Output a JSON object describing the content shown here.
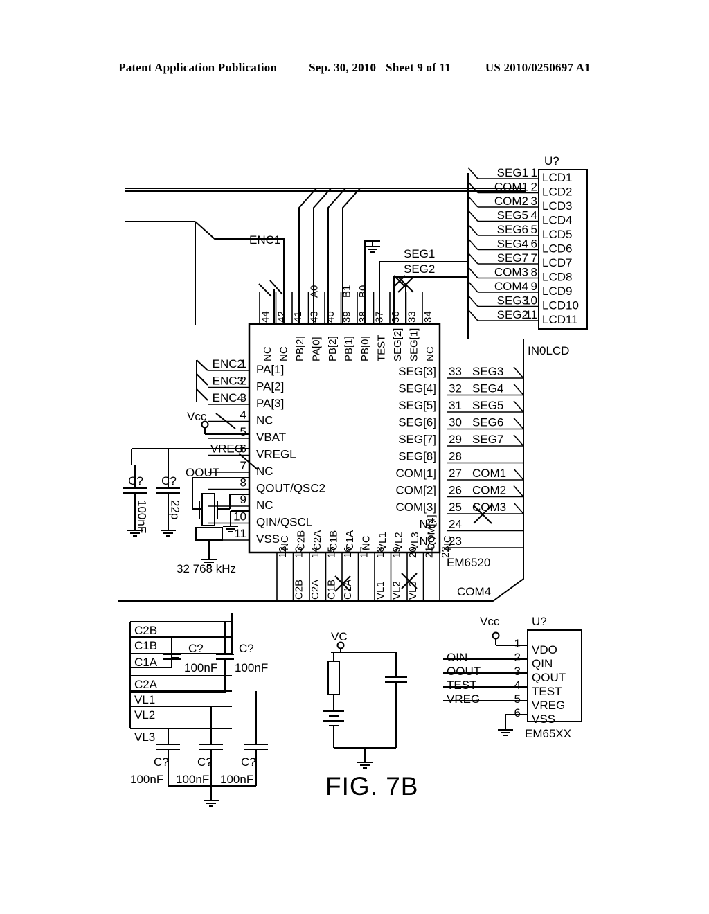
{
  "header": {
    "left": "Patent Application Publication",
    "date": "Sep. 30, 2010",
    "sheet": "Sheet 9 of 11",
    "number": "US 2010/0250697 A1"
  },
  "figure": {
    "caption": "FIG. 7B"
  },
  "lcd_connector": {
    "ref": "U?",
    "name": "IN0LCD",
    "rows": [
      {
        "net": "SEG1",
        "pin": "1",
        "label": "LCD1"
      },
      {
        "net": "COM1",
        "pin": "2",
        "label": "LCD2"
      },
      {
        "net": "COM2",
        "pin": "3",
        "label": "LCD3"
      },
      {
        "net": "SEG5",
        "pin": "4",
        "label": "LCD4"
      },
      {
        "net": "SEG6",
        "pin": "5",
        "label": "LCD5"
      },
      {
        "net": "SEG4",
        "pin": "6",
        "label": "LCD6"
      },
      {
        "net": "SEG7",
        "pin": "7",
        "label": "LCD7"
      },
      {
        "net": "COM3",
        "pin": "8",
        "label": "LCD8"
      },
      {
        "net": "COM4",
        "pin": "9",
        "label": "LCD9"
      },
      {
        "net": "SEG3",
        "pin": "10",
        "label": "LCD10"
      },
      {
        "net": "SEG2",
        "pin": "11",
        "label": "LCD11"
      }
    ]
  },
  "main_ic": {
    "name": "EM6520",
    "left_pins": [
      {
        "pin": "1",
        "label": "PA[1]",
        "net": "ENC2"
      },
      {
        "pin": "2",
        "label": "PA[2]",
        "net": "ENC3"
      },
      {
        "pin": "3",
        "label": "PA[3]",
        "net": "ENC4"
      },
      {
        "pin": "4",
        "label": "NC",
        "net": ""
      },
      {
        "pin": "5",
        "label": "VBAT",
        "net": "Vcc"
      },
      {
        "pin": "6",
        "label": "VREGL",
        "net": "VREG"
      },
      {
        "pin": "7",
        "label": "NC",
        "net": ""
      },
      {
        "pin": "8",
        "label": "QOUT/QSC2",
        "net": "OOUT"
      },
      {
        "pin": "9",
        "label": "NC",
        "net": ""
      },
      {
        "pin": "10",
        "label": "QIN/QSCL",
        "net": ""
      },
      {
        "pin": "11",
        "label": "VSS",
        "net": ""
      }
    ],
    "right_pins": [
      {
        "pin": "33",
        "label": "SEG[3]",
        "net": "SEG3"
      },
      {
        "pin": "32",
        "label": "SEG[4]",
        "net": "SEG4"
      },
      {
        "pin": "31",
        "label": "SEG[5]",
        "net": "SEG5"
      },
      {
        "pin": "30",
        "label": "SEG[6]",
        "net": "SEG6"
      },
      {
        "pin": "29",
        "label": "SEG[7]",
        "net": "SEG7"
      },
      {
        "pin": "28",
        "label": "SEG[8]",
        "net": ""
      },
      {
        "pin": "27",
        "label": "COM[1]",
        "net": "COM1"
      },
      {
        "pin": "26",
        "label": "COM[2]",
        "net": "COM2"
      },
      {
        "pin": "25",
        "label": "COM[3]",
        "net": "COM3"
      },
      {
        "pin": "24",
        "label": "NC",
        "net": ""
      },
      {
        "pin": "23",
        "label": "NC",
        "net": ""
      }
    ],
    "top_pins": [
      {
        "pin": "44",
        "label": "NC",
        "net": ""
      },
      {
        "pin": "42",
        "label": "NC",
        "net": ""
      },
      {
        "pin": "41",
        "label": "PB[2]",
        "net": ""
      },
      {
        "pin": "43",
        "label": "PA[0]",
        "net": "A0"
      },
      {
        "pin": "40",
        "label": "PB[2]",
        "net": ""
      },
      {
        "pin": "39",
        "label": "PB[1]",
        "net": "B1"
      },
      {
        "pin": "38",
        "label": "PB[0]",
        "net": "B0"
      },
      {
        "pin": "37",
        "label": "TEST",
        "net": ""
      },
      {
        "pin": "36",
        "label": "SEG[2]",
        "net": ""
      },
      {
        "pin": "33",
        "label": "SEG[1]",
        "net": ""
      },
      {
        "pin": "34",
        "label": "NC",
        "net": ""
      }
    ],
    "bottom_pins": [
      {
        "pin": "12",
        "label": "NC",
        "net": ""
      },
      {
        "pin": "13",
        "label": "C2B",
        "net": "C2B"
      },
      {
        "pin": "14",
        "label": "C2A",
        "net": "C2A"
      },
      {
        "pin": "15",
        "label": "C1B",
        "net": "C1B"
      },
      {
        "pin": "16",
        "label": "C1A",
        "net": "C1A"
      },
      {
        "pin": "17",
        "label": "NC",
        "net": ""
      },
      {
        "pin": "18",
        "label": "VL1",
        "net": "VL1"
      },
      {
        "pin": "19",
        "label": "VL2",
        "net": "VL2"
      },
      {
        "pin": "20",
        "label": "VL3",
        "net": "VL3"
      },
      {
        "pin": "21",
        "label": "COM[4]",
        "net": ""
      },
      {
        "pin": "22",
        "label": "NC",
        "net": ""
      }
    ],
    "bottom_net": "COM4"
  },
  "nets": {
    "enc1": "ENC1",
    "seg1": "SEG1",
    "seg2": "SEG2"
  },
  "oscillator": {
    "cap1_ref": "C?",
    "cap1_value": "100nF",
    "cap2_ref": "C?",
    "cap2_value": "22p",
    "crystal": "32 768 kHz",
    "out_net": "OOUT"
  },
  "charge_pump": {
    "labels": [
      "C2B",
      "C1B",
      "C1A",
      "C2A",
      "VL1",
      "VL2",
      "VL3"
    ],
    "caps_top": [
      {
        "ref": "C?",
        "value": "100nF"
      },
      {
        "ref": "C?",
        "value": "100nF"
      }
    ],
    "caps_bottom": [
      {
        "ref": "C?",
        "value": "100nF"
      },
      {
        "ref": "C?",
        "value": "100nF"
      },
      {
        "ref": "C?",
        "value": "100nF"
      }
    ]
  },
  "vc_block": {
    "label": "VC"
  },
  "em65xx": {
    "ref": "U?",
    "name": "EM65XX",
    "vcc": "Vcc",
    "rows": [
      {
        "net": "",
        "pin": "1",
        "label": "VDO"
      },
      {
        "net": "OIN",
        "pin": "2",
        "label": "QIN"
      },
      {
        "net": "OOUT",
        "pin": "3",
        "label": "QOUT"
      },
      {
        "net": "TEST",
        "pin": "4",
        "label": "TEST"
      },
      {
        "net": "VREG",
        "pin": "5",
        "label": "VREG"
      },
      {
        "net": "",
        "pin": "6",
        "label": "VSS"
      }
    ]
  }
}
